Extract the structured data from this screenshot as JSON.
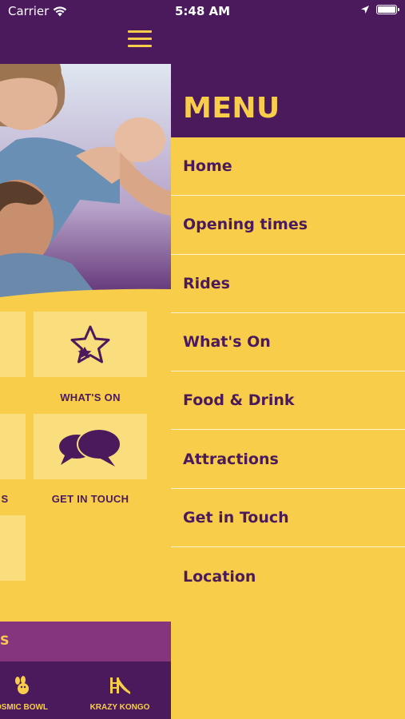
{
  "status_bar": {
    "carrier": "Carrier",
    "time": "5:48 AM"
  },
  "background_app": {
    "tiles": [
      {
        "label": "WHAT'S ON",
        "icon": "star-icon"
      },
      {
        "label": "GET IN TOUCH",
        "icon": "chat-bubbles-icon"
      }
    ],
    "partial_labels": [
      "S"
    ],
    "banner_text": "S",
    "tabs": [
      {
        "label": "OSMIC BOWL",
        "icon": "bowling-icon"
      },
      {
        "label": "KRAZY KONGO",
        "icon": "slide-icon"
      }
    ]
  },
  "menu": {
    "title": "MENU",
    "items": [
      {
        "label": "Home"
      },
      {
        "label": "Opening times"
      },
      {
        "label": "Rides"
      },
      {
        "label": "What's On"
      },
      {
        "label": "Food & Drink"
      },
      {
        "label": "Attractions"
      },
      {
        "label": "Get in Touch"
      },
      {
        "label": "Location"
      }
    ]
  },
  "colors": {
    "purple": "#4b1a5c",
    "yellow": "#f7cd4a",
    "tile": "#fadd7c",
    "banner": "#84357d"
  }
}
